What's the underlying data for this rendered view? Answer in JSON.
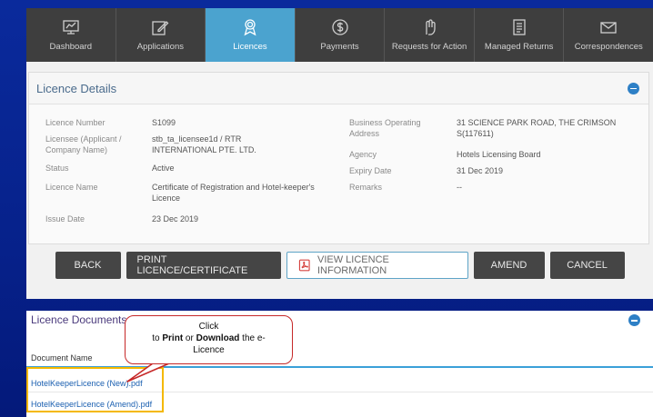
{
  "nav": {
    "items": [
      {
        "label": "Dashboard",
        "icon": "dashboard-icon",
        "active": false
      },
      {
        "label": "Applications",
        "icon": "edit-icon",
        "active": false
      },
      {
        "label": "Licences",
        "icon": "award-icon",
        "active": true
      },
      {
        "label": "Payments",
        "icon": "dollar-icon",
        "active": false
      },
      {
        "label": "Requests for Action",
        "icon": "hand-icon",
        "active": false
      },
      {
        "label": "Managed Returns",
        "icon": "document-icon",
        "active": false
      },
      {
        "label": "Correspondences",
        "icon": "mail-icon",
        "active": false
      }
    ]
  },
  "details": {
    "title": "Licence Details",
    "licence_number_label": "Licence Number",
    "licence_number": "S1099",
    "licensee_label": "Licensee (Applicant / Company Name)",
    "licensee": "stb_ta_licensee1d / RTR INTERNATIONAL PTE. LTD.",
    "status_label": "Status",
    "status": "Active",
    "licence_name_label": "Licence Name",
    "licence_name": "Certificate of Registration and Hotel-keeper's Licence",
    "issue_date_label": "Issue Date",
    "issue_date": "23 Dec 2019",
    "business_address_label": "Business Operating Address",
    "business_address": "31 SCIENCE PARK ROAD, THE CRIMSON S(117611)",
    "agency_label": "Agency",
    "agency": "Hotels Licensing Board",
    "expiry_date_label": "Expiry Date",
    "expiry_date": "31 Dec 2019",
    "remarks_label": "Remarks",
    "remarks": "--"
  },
  "buttons": {
    "back": "BACK",
    "print": "PRINT LICENCE/CERTIFICATE",
    "view": "VIEW LICENCE INFORMATION",
    "amend": "AMEND",
    "cancel": "CANCEL"
  },
  "documents": {
    "title": "Licence Documents",
    "column": "Document Name",
    "files": [
      "HotelKeeperLicence (New).pdf",
      "HotelKeeperLicence (Amend).pdf"
    ]
  },
  "callout": {
    "line1": "Click",
    "prefix": "to ",
    "bold1": "Print",
    "mid": " or ",
    "bold2": "Download",
    "suffix": " the e-",
    "line3": "Licence"
  },
  "colors": {
    "background": "#0a2a9c",
    "nav_bg": "#3e3e3e",
    "nav_active": "#4ba3cf",
    "callout_border": "#c62828",
    "highlight": "#f4b800"
  }
}
